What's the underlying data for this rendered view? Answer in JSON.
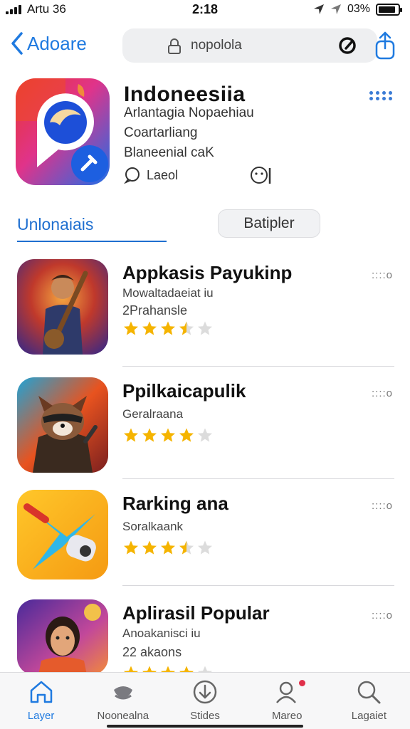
{
  "status_bar": {
    "carrier": "Artu 36",
    "time": "2:18",
    "battery_text": "03%",
    "battery_level": 0.9
  },
  "nav": {
    "back_label": "Adoare",
    "search_text": "nopolola",
    "icons": {
      "back": "chevron-left-icon",
      "lock": "lock-icon",
      "reload": "reload-icon",
      "share": "share-icon"
    }
  },
  "app": {
    "title": "Indoneesiia",
    "subtitle1": "Arlantagia Nopaehiau",
    "subtitle2": "Coartarliang",
    "subtitle3": "Blaneenial caK",
    "link_label": "Laeol"
  },
  "tabs": {
    "active_label": "Unlonaiais",
    "button_label": "Batipler"
  },
  "apps": [
    {
      "name": "Appkasis Payukinp",
      "line1": "Mowaltadaeiat iu",
      "line2": "2Prahansle",
      "rating": 3.5
    },
    {
      "name": "Ppilkaicapulik",
      "line1": "Geralraana",
      "line2": "",
      "rating": 4
    },
    {
      "name": "Rarking ana",
      "line1": "Soralkaank",
      "line2": "",
      "rating": 3.5
    },
    {
      "name": "Aplirasil Popular",
      "line1": "Anoakanisci iu",
      "line2": "22 akaons",
      "rating": 4
    }
  ],
  "list_more_label": "::::o",
  "tab_bar": {
    "items": [
      {
        "label": "Layer",
        "icon": "home-icon"
      },
      {
        "label": "Noonealna",
        "icon": "stack-icon"
      },
      {
        "label": "Stides",
        "icon": "download-icon"
      },
      {
        "label": "Mareo",
        "icon": "person-icon"
      },
      {
        "label": "Lagaiet",
        "icon": "search-icon"
      }
    ]
  },
  "colors": {
    "accent": "#1f7ae0",
    "star": "#f5b400",
    "star_empty": "#dcdcdc"
  }
}
